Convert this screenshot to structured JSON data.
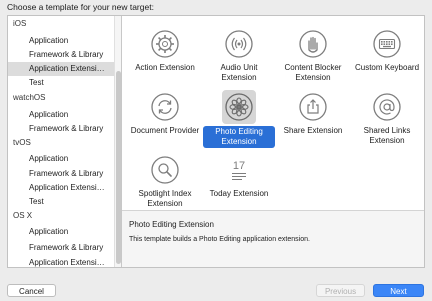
{
  "dialog": {
    "title": "Choose a template for your new target:"
  },
  "sidebar": {
    "rows": [
      {
        "type": "header",
        "label": "iOS"
      },
      {
        "type": "item",
        "label": "Application"
      },
      {
        "type": "item",
        "label": "Framework & Library"
      },
      {
        "type": "item",
        "label": "Application Extensi…",
        "selected": true
      },
      {
        "type": "item",
        "label": "Test"
      },
      {
        "type": "header",
        "label": "watchOS"
      },
      {
        "type": "item",
        "label": "Application"
      },
      {
        "type": "item",
        "label": "Framework & Library"
      },
      {
        "type": "header",
        "label": "tvOS"
      },
      {
        "type": "item",
        "label": "Application"
      },
      {
        "type": "item",
        "label": "Framework & Library"
      },
      {
        "type": "item",
        "label": "Application Extensi…"
      },
      {
        "type": "item",
        "label": "Test"
      },
      {
        "type": "header",
        "label": "OS X"
      },
      {
        "type": "item",
        "label": "Application"
      },
      {
        "type": "item",
        "label": "Framework & Library"
      },
      {
        "type": "item",
        "label": "Application Extensi…"
      }
    ]
  },
  "templates": [
    {
      "label": "Action Extension",
      "icon": "gear-icon"
    },
    {
      "label": "Audio Unit Extension",
      "icon": "audio-wave-icon"
    },
    {
      "label": "Content Blocker Extension",
      "icon": "hand-icon"
    },
    {
      "label": "Custom Keyboard",
      "icon": "keyboard-icon"
    },
    {
      "label": "Document Provider",
      "icon": "refresh-arrows-icon"
    },
    {
      "label": "Photo Editing Extension",
      "icon": "flower-icon",
      "selected": true
    },
    {
      "label": "Share Extension",
      "icon": "share-icon"
    },
    {
      "label": "Shared Links Extension",
      "icon": "at-sign-icon"
    },
    {
      "label": "Spotlight Index Extension",
      "icon": "magnifier-icon"
    },
    {
      "label": "Today Extension",
      "icon": "calendar-icon"
    }
  ],
  "description": {
    "title": "Photo Editing Extension",
    "text": "This template builds a Photo Editing application extension."
  },
  "buttons": {
    "cancel": "Cancel",
    "previous": "Previous",
    "next": "Next"
  },
  "colors": {
    "accent": "#2a6fd6",
    "next_button": "#3b86f7",
    "icon_stroke": "#7d7d7d"
  }
}
